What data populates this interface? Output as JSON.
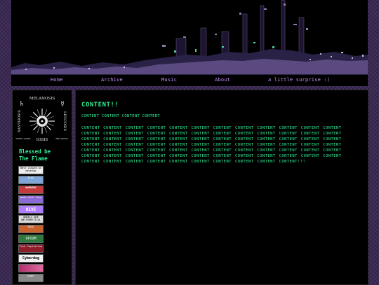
{
  "nav": {
    "items": [
      "Home",
      "Archive",
      "Music",
      "About",
      "a little surprise :)"
    ]
  },
  "sidebar": {
    "emblem": {
      "top": "MELANOSIS",
      "left": "XANTHOSIS",
      "right": "LEUCOSIS",
      "bottom": "IOSIS",
      "small_left": "NIGRO ALBAE",
      "small_right": "TRIA SIGNA"
    },
    "blessed_line1": "Blessed be",
    "blessed_line2": "The Flame",
    "badges": [
      "Best viewed on desktop",
      "BLOG",
      "WARNING",
      "made with love",
      "HIVE",
      "ANGELS ARE ANTIHERETICAL",
      "ROCK",
      "OPIUM",
      "Fuck Capitalism",
      "Cyberdog",
      "",
      "Angel"
    ]
  },
  "content": {
    "heading": "CONTENT!!",
    "subheading": "CONTENT CONTENT CONTENT CONTENT",
    "body": "CONTENT CONTENT CONTENT CONTENT CONTENT CONTENT CONTENT CONTENT CONTENT CONTENT CONTENT CONTENT CONTENT CONTENT CONTENT CONTENT CONTENT CONTENT CONTENT CONTENT CONTENT CONTENT CONTENT CONTENT CONTENT CONTENT CONTENT CONTENT CONTENT CONTENT CONTENT CONTENT CONTENT CONTENT CONTENT CONTENT CONTENT CONTENT CONTENT CONTENT CONTENT CONTENT CONTENT CONTENT CONTENT CONTENT CONTENT CONTENT CONTENT CONTENT CONTENT CONTENT CONTENT CONTENT CONTENT CONTENT CONTENT CONTENT CONTENT CONTENT CONTENT CONTENT CONTENT CONTENT CONTENT CONTENT CONTENT CONTENT CONTENT CONTENT CONTENT CONTENT CONTENT CONTENT CONTENT CONTENT CONTENT CONTENT CONTENT CONTENT CONTENT CONTENT!!!"
  },
  "colors": {
    "accent_green": "#32ef96",
    "nav_purple": "#c58cf2",
    "page_background": "#3b2a52"
  }
}
